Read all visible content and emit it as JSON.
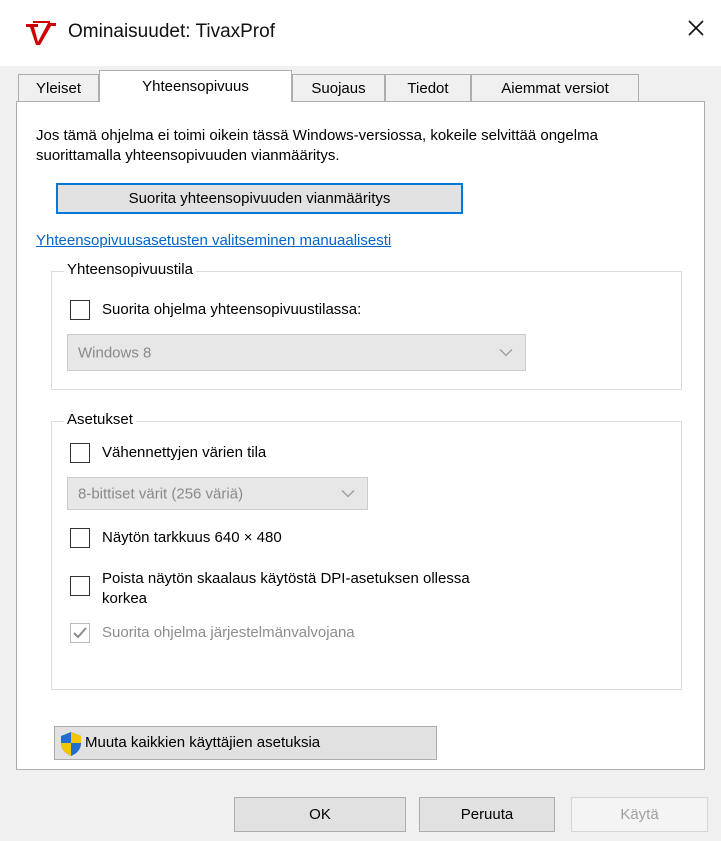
{
  "window": {
    "title": "Ominaisuudet: TivaxProf"
  },
  "tabs": [
    {
      "label": "Yleiset"
    },
    {
      "label": "Yhteensopivuus"
    },
    {
      "label": "Suojaus"
    },
    {
      "label": "Tiedot"
    },
    {
      "label": "Aiemmat versiot"
    }
  ],
  "active_tab": "Yhteensopivuus",
  "compat": {
    "intro": "Jos tämä ohjelma ei toimi oikein tässä Windows-versiossa, kokeile selvittää ongelma suorittamalla yhteensopivuuden vianmääritys.",
    "troubleshoot_button": "Suorita yhteensopivuuden vianmääritys",
    "manual_link": "Yhteensopivuusasetusten valitseminen manuaalisesti",
    "mode_group": {
      "legend": "Yhteensopivuustila",
      "checkbox_label": "Suorita ohjelma yhteensopivuustilassa:",
      "checked": false,
      "os_select_value": "Windows 8"
    },
    "settings_group": {
      "legend": "Asetukset",
      "reduced_color_label": "Vähennettyjen värien tila",
      "reduced_color_checked": false,
      "color_select_value": "8-bittiset värit (256 väriä)",
      "resolution_label": "Näytön tarkkuus 640 × 480",
      "resolution_checked": false,
      "dpi_label_line1": "Poista näytön skaalaus käytöstä DPI-asetuksen ollessa",
      "dpi_label_line2": "korkea",
      "dpi_checked": false,
      "admin_label": "Suorita ohjelma järjestelmänvalvojana",
      "admin_checked": true
    },
    "all_users_button": "Muuta kaikkien käyttäjien asetuksia"
  },
  "footer": {
    "ok": "OK",
    "cancel": "Peruuta",
    "apply": "Käytä"
  },
  "colors": {
    "link": "#0066cc",
    "focus": "#0078d7",
    "app_icon_red": "#cc0000",
    "shield_blue": "#1f6fd0",
    "shield_yellow": "#f7c400"
  }
}
